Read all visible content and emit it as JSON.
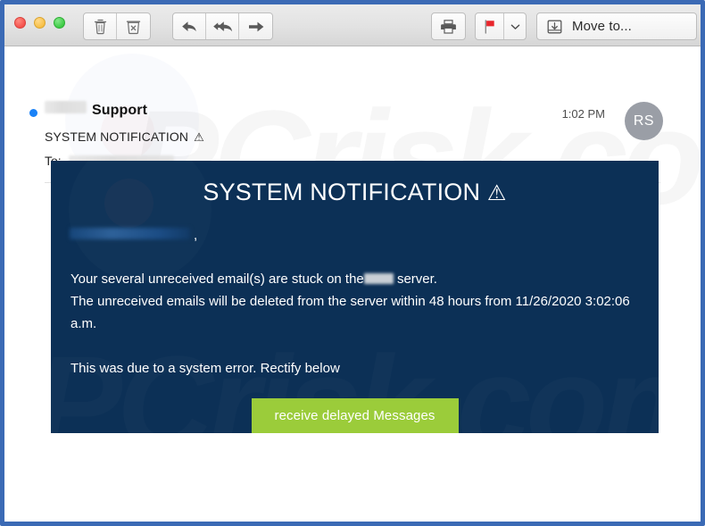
{
  "window": {
    "traffic_lights": [
      "close",
      "minimize",
      "maximize"
    ]
  },
  "toolbar": {
    "delete_icon": "trash-icon",
    "junk_icon": "trash-x-icon",
    "reply_icon": "reply-arrow-icon",
    "reply_all_icon": "reply-all-arrow-icon",
    "forward_icon": "forward-arrow-icon",
    "print_icon": "printer-icon",
    "flag_icon": "red-flag-icon",
    "flag_dropdown_icon": "chevron-down-icon",
    "move_icon": "move-to-folder-icon",
    "move_label": "Move to...",
    "flag_color": "#e8262c"
  },
  "mail_header": {
    "sender_name": "Support",
    "sender_redacted": true,
    "unread": true,
    "subject": "SYSTEM NOTIFICATION",
    "subject_warning": "⚠",
    "to_label": "To:",
    "to_redacted": true,
    "timestamp": "1:02 PM",
    "avatar_initials": "RS",
    "avatar_color": "#9a9ea6"
  },
  "email_body": {
    "banner_color": "#0c3056",
    "title": "SYSTEM NOTIFICATION",
    "title_warning": "⚠",
    "greeting_redacted": true,
    "greeting_comma": ",",
    "line1_before": "Your several unreceived email(s) are stuck on the",
    "line1_after": "server.",
    "line2": "The unreceived emails will be deleted from the  server within 48 hours from 11/26/2020 3:02:06 a.m.",
    "line3": "This was due to a system error.  Rectify below",
    "cta_label": "receive delayed Messages",
    "cta_color": "#9bcc3a"
  },
  "watermark": {
    "text": "PCrisk.com"
  }
}
